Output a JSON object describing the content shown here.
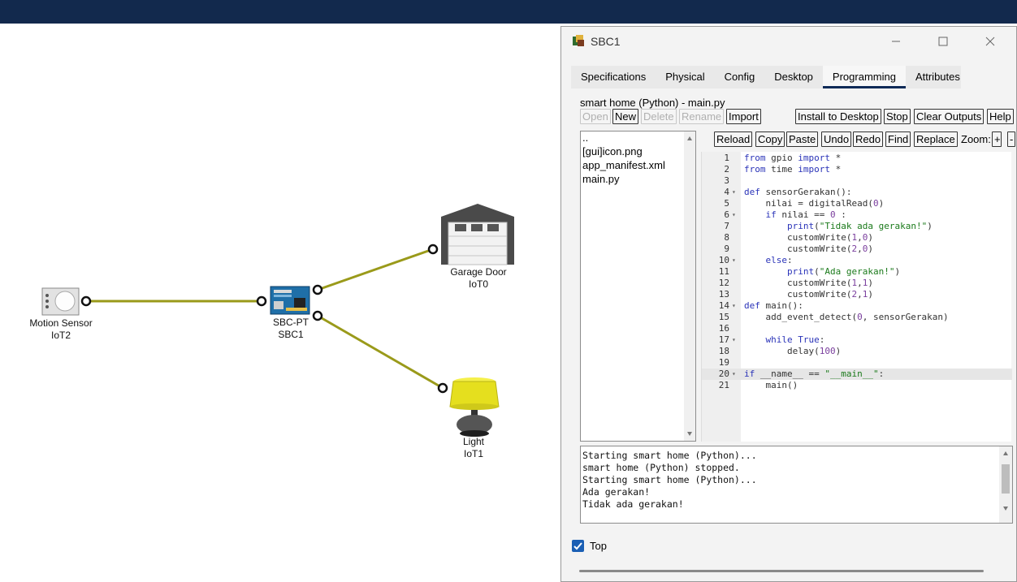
{
  "window": {
    "title": "SBC1",
    "tabs": [
      "Specifications",
      "Physical",
      "Config",
      "Desktop",
      "Programming",
      "Attributes"
    ],
    "active_tab": "Programming"
  },
  "devices": {
    "motion_sensor": {
      "name": "Motion Sensor",
      "id": "IoT2"
    },
    "sbc": {
      "name": "SBC-PT",
      "id": "SBC1"
    },
    "garage": {
      "name": "Garage Door",
      "id": "IoT0"
    },
    "light": {
      "name": "Light",
      "id": "IoT1"
    }
  },
  "programming": {
    "project_title": "smart home (Python) - main.py",
    "file_buttons": {
      "open": "Open",
      "new": "New",
      "delete": "Delete",
      "rename": "Rename",
      "import": "Import"
    },
    "run_buttons": {
      "install": "Install to Desktop",
      "stop": "Stop",
      "clear": "Clear Outputs",
      "help": "Help"
    },
    "files": [
      "..",
      "[gui]icon.png",
      "app_manifest.xml",
      "main.py"
    ],
    "editor_buttons": {
      "reload": "Reload",
      "copy": "Copy",
      "paste": "Paste",
      "undo": "Undo",
      "redo": "Redo",
      "find": "Find",
      "replace": "Replace",
      "zoom_label": "Zoom:",
      "zoom_in": "+",
      "zoom_out": "-"
    },
    "code_lines": [
      "from gpio import *",
      "from time import *",
      "",
      "def sensorGerakan():",
      "    nilai = digitalRead(0)",
      "    if nilai == 0 :",
      "        print(\"Tidak ada gerakan!\")",
      "        customWrite(1,0)",
      "        customWrite(2,0)",
      "    else:",
      "        print(\"Ada gerakan!\")",
      "        customWrite(1,1)",
      "        customWrite(2,1)",
      "def main():",
      "    add_event_detect(0, sensorGerakan)",
      "",
      "    while True:",
      "        delay(100)",
      "",
      "if __name__ == \"__main__\":",
      "    main()"
    ],
    "output_lines": [
      "Starting smart home (Python)...",
      "smart home (Python) stopped.",
      "Starting smart home (Python)...",
      "Ada gerakan!",
      "Tidak ada gerakan!"
    ],
    "top_checkbox": {
      "label": "Top",
      "checked": true
    }
  },
  "colors": {
    "top_bar": "#12294d",
    "link": "#9a9a1a",
    "accent": "#0f2a57",
    "checkbox": "#1a5fb4"
  }
}
